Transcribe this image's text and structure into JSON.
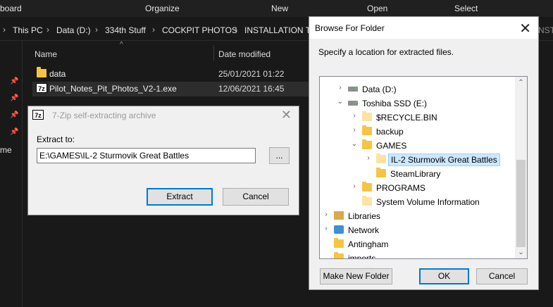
{
  "ribbon": {
    "items": [
      "board",
      "Organize",
      "New",
      "Open",
      "Select"
    ]
  },
  "address": {
    "crumbs": [
      "This PC",
      "Data (D:)",
      "334th Stuff",
      "COCKPIT PHOTOS",
      "INSTALLATION TF"
    ],
    "right_fragment": "NST"
  },
  "leftnav": {
    "partial_text": "me"
  },
  "filelist": {
    "columns": {
      "name": "Name",
      "date": "Date modified"
    },
    "rows": [
      {
        "name": "data",
        "date": "25/01/2021 01:22",
        "icon": "folder-icon"
      },
      {
        "name": "Pilot_Notes_Pit_Photos_V2-1.exe",
        "date": "12/06/2021 16:45",
        "icon": "7zip-exe-icon"
      }
    ]
  },
  "zip_dialog": {
    "title": "7-Zip self-extracting archive",
    "icon_text": "7z",
    "extract_label": "Extract to:",
    "path_value": "E:\\GAMES\\IL-2 Sturmovik Great Battles",
    "browse_label": "...",
    "extract_button": "Extract",
    "cancel_button": "Cancel",
    "close_glyph": "✕"
  },
  "browse_dialog": {
    "title": "Browse For Folder",
    "instruction": "Specify a location for extracted files.",
    "close_glyph": "✕",
    "tree": [
      {
        "label": "Data (D:)",
        "icon": "drive",
        "chev": "›"
      },
      {
        "label": "Toshiba SSD (E:)",
        "icon": "drive",
        "chev": "⌄"
      },
      {
        "label": "$RECYCLE.BIN",
        "icon": "folder-pale",
        "chev": "›"
      },
      {
        "label": "backup",
        "icon": "folder",
        "chev": "›"
      },
      {
        "label": "GAMES",
        "icon": "folder",
        "chev": "⌄"
      },
      {
        "label": "IL-2 Sturmovik Great Battles",
        "icon": "folder-pale",
        "chev": "›"
      },
      {
        "label": "SteamLibrary",
        "icon": "folder",
        "chev": ""
      },
      {
        "label": "PROGRAMS",
        "icon": "folder",
        "chev": "›"
      },
      {
        "label": "System Volume Information",
        "icon": "folder-pale",
        "chev": ""
      },
      {
        "label": "Libraries",
        "icon": "libraries",
        "chev": "›"
      },
      {
        "label": "Network",
        "icon": "network",
        "chev": "›"
      },
      {
        "label": "Antingham",
        "icon": "folder",
        "chev": ""
      },
      {
        "label": "imports",
        "icon": "folder",
        "chev": ""
      }
    ],
    "make_folder_button": "Make New Folder",
    "ok_button": "OK",
    "cancel_button": "Cancel"
  }
}
